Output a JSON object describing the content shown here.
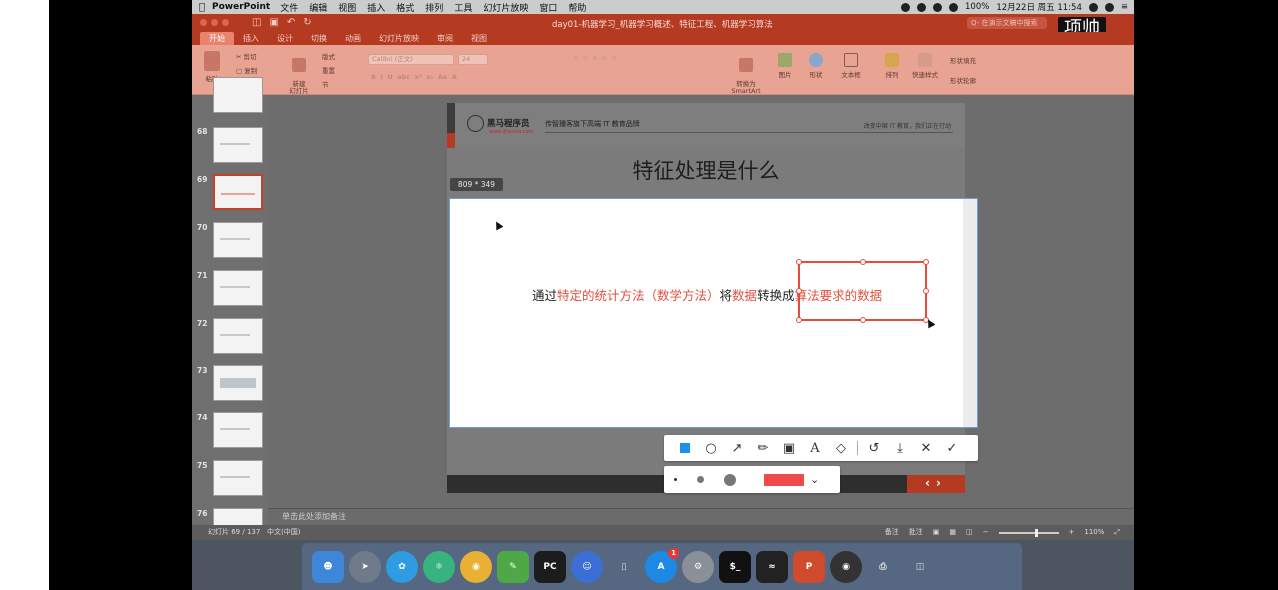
{
  "menubar": {
    "app_name": "PowerPoint",
    "items": [
      "文件",
      "编辑",
      "视图",
      "插入",
      "格式",
      "排列",
      "工具",
      "幻灯片放映",
      "窗口",
      "帮助"
    ],
    "battery": "100%",
    "datetime": "12月22日 周五 11:54"
  },
  "window": {
    "doc_title": "day01-机器学习_机器学习概述、特征工程、机器学习算法",
    "search_placeholder": "Q- 在演示文稿中搜索",
    "sticker_text": "项帅",
    "tabs": [
      "开始",
      "插入",
      "设计",
      "切换",
      "动画",
      "幻灯片放映",
      "审阅",
      "视图"
    ],
    "active_tab": "开始"
  },
  "ribbon": {
    "paste": "粘贴",
    "cut": "剪切",
    "copy": "复制",
    "format": "格式",
    "new_slide": "新建\n幻灯片",
    "layout": "版式",
    "reset": "重置",
    "section": "节",
    "font_name": "Calibri (正文)",
    "font_size": "24",
    "convert_smartart": "转换为\nSmartArt",
    "picture": "图片",
    "shape": "形状",
    "textbox": "文本框",
    "arrange": "排列",
    "quick_styles": "快速样式",
    "shape_fill": "形状填充",
    "shape_outline": "形状轮廓"
  },
  "slides_panel": {
    "numbers": [
      "68",
      "69",
      "70",
      "71",
      "72",
      "73",
      "74",
      "75",
      "76"
    ],
    "selected": "69"
  },
  "slide": {
    "brand": "黑马程序员",
    "brand_url": "www.itheima.com",
    "tagline": "传智播客旗下高端 IT 教育品牌",
    "slogan": "改变中国 IT 教育，我们正在行动",
    "title": "特征处理是什么"
  },
  "capture": {
    "size_label": "809 * 349",
    "text_prefix": "通过",
    "text_red1": "特定的统计方法（数学方法）",
    "text_mid1": "将",
    "text_red2": "数据",
    "text_mid2": "转换成",
    "text_red3": "算法要求的数据",
    "annotation_color": "#f04a4a"
  },
  "toolbar": {
    "tools": [
      "rectangle-icon",
      "circle-icon",
      "arrow-icon",
      "pen-icon",
      "mosaic-icon",
      "text-icon",
      "eraser-icon",
      "undo-icon",
      "download-icon",
      "close-icon",
      "check-icon"
    ],
    "selected_tool": "rectangle-icon"
  },
  "notes": {
    "placeholder": "单击此处添加备注"
  },
  "status": {
    "slide_info": "幻灯片 69 / 137",
    "language": "中文(中国)",
    "notes_btn": "备注",
    "comments_btn": "批注",
    "zoom": "110%"
  },
  "dock": {
    "mail_badge": "1"
  }
}
